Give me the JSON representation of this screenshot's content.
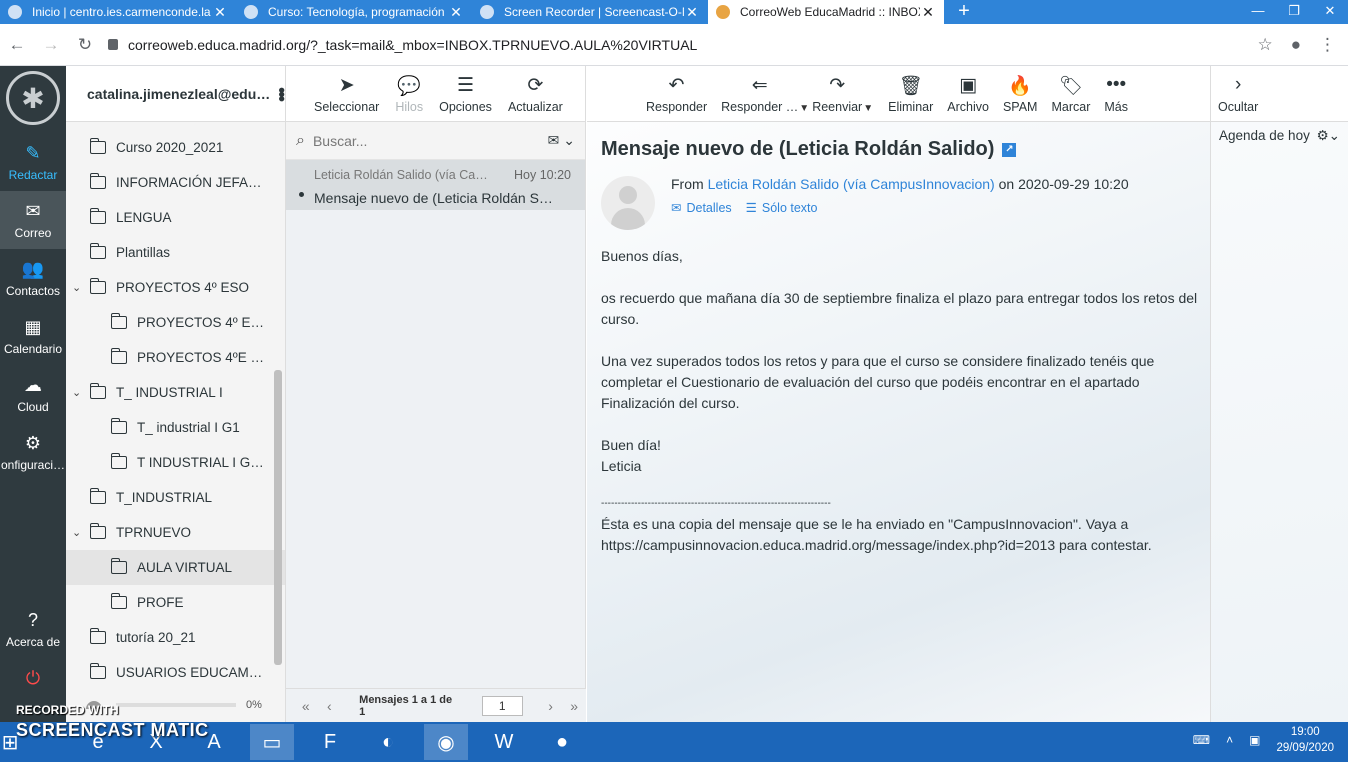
{
  "browser": {
    "tabs": [
      {
        "title": "Inicio | centro.ies.carmenconde.la",
        "close": "✕"
      },
      {
        "title": "Curso: Tecnología, programación",
        "close": "✕"
      },
      {
        "title": "Screen Recorder | Screencast-O-M",
        "close": "✕"
      },
      {
        "title": "CorreoWeb EducaMadrid :: INBOX",
        "close": "✕"
      }
    ],
    "new_tab": "+",
    "url": "correoweb.educa.madrid.org/?_task=mail&_mbox=INBOX.TPRNUEVO.AULA%20VIRTUAL"
  },
  "nav": {
    "items": [
      {
        "label": "Redactar",
        "icon": "compose-icon"
      },
      {
        "label": "Correo",
        "icon": "mail-icon"
      },
      {
        "label": "Contactos",
        "icon": "contacts-icon"
      },
      {
        "label": "Calendario",
        "icon": "calendar-icon"
      },
      {
        "label": "Cloud",
        "icon": "cloud-icon"
      },
      {
        "label": "onfiguraci…",
        "icon": "gear-icon"
      },
      {
        "label": "Acerca de",
        "icon": "help-icon"
      }
    ]
  },
  "account": {
    "email": "catalina.jimenezleal@edu…"
  },
  "folders": [
    {
      "name": "Curso 2020_2021",
      "level": 0,
      "caret": ""
    },
    {
      "name": "INFORMACIÓN JEFA…",
      "level": 0,
      "caret": ""
    },
    {
      "name": "LENGUA",
      "level": 0,
      "caret": ""
    },
    {
      "name": "Plantillas",
      "level": 0,
      "caret": ""
    },
    {
      "name": "PROYECTOS 4º ESO",
      "level": 0,
      "caret": "⌄"
    },
    {
      "name": "PROYECTOS 4º E…",
      "level": 1,
      "caret": ""
    },
    {
      "name": "PROYECTOS 4ºE …",
      "level": 1,
      "caret": ""
    },
    {
      "name": "T_ INDUSTRIAL I",
      "level": 0,
      "caret": "⌄"
    },
    {
      "name": "T_ industrial I G1",
      "level": 1,
      "caret": ""
    },
    {
      "name": "T INDUSTRIAL I G…",
      "level": 1,
      "caret": ""
    },
    {
      "name": "T_INDUSTRIAL",
      "level": 0,
      "caret": ""
    },
    {
      "name": "TPRNUEVO",
      "level": 0,
      "caret": "⌄"
    },
    {
      "name": "AULA VIRTUAL",
      "level": 1,
      "caret": "",
      "selected": true
    },
    {
      "name": "PROFE",
      "level": 1,
      "caret": ""
    },
    {
      "name": "tutoría 20_21",
      "level": 0,
      "caret": ""
    },
    {
      "name": "USUARIOS EDUCAM…",
      "level": 0,
      "caret": ""
    }
  ],
  "quota": {
    "percent": "0%"
  },
  "list_toolbar": {
    "select": "Seleccionar",
    "threads": "Hilos",
    "options": "Opciones",
    "refresh": "Actualizar"
  },
  "search": {
    "placeholder": "Buscar..."
  },
  "messages": [
    {
      "from": "Leticia Roldán Salido (vía Ca…",
      "date": "Hoy 10:20",
      "subject": "Mensaje nuevo de (Leticia Roldán S…"
    }
  ],
  "pager": {
    "label": "Mensajes 1 a 1 de 1",
    "page": "1"
  },
  "msg_toolbar": {
    "reply": "Responder",
    "reply_all": "Responder …",
    "forward": "Reenviar",
    "delete": "Eliminar",
    "archive": "Archivo",
    "spam": "SPAM",
    "mark": "Marcar",
    "more": "Más",
    "hide": "Ocultar"
  },
  "message": {
    "subject": "Mensaje nuevo de (Leticia Roldán Salido)",
    "from_label": "From",
    "from_name": "Leticia Roldán Salido (vía CampusInnovacion)",
    "date_text": "on 2020-09-29 10:20",
    "details": "Detalles",
    "plain": "Sólo texto",
    "body": [
      "Buenos días,",
      "os recuerdo que mañana día 30 de septiembre finaliza el plazo para entregar todos los retos del curso.",
      "Una vez superados todos los retos y para que el curso se considere finalizado tenéis que completar el Cuestionario de evaluación del curso que podéis encontrar en el apartado Finalización del curso.",
      "Buen día!",
      "Leticia",
      "---------------------------------------------------------------------",
      "Ésta es una copia del mensaje que se le ha enviado en \"CampusInnovacion\". Vaya a https://campusinnovacion.educa.madrid.org/message/index.php?id=2013 para contestar."
    ]
  },
  "agenda": {
    "title": "Agenda de hoy"
  },
  "taskbar": {
    "time": "19:00",
    "date": "29/09/2020"
  },
  "watermark": {
    "line1": "RECORDED WITH",
    "line2": "SCREENCAST  MATIC"
  },
  "colors": {
    "accent": "#2f84d8",
    "sidebar": "#2f3a3f",
    "compose": "#37beff",
    "taskbar": "#1c66b9"
  }
}
